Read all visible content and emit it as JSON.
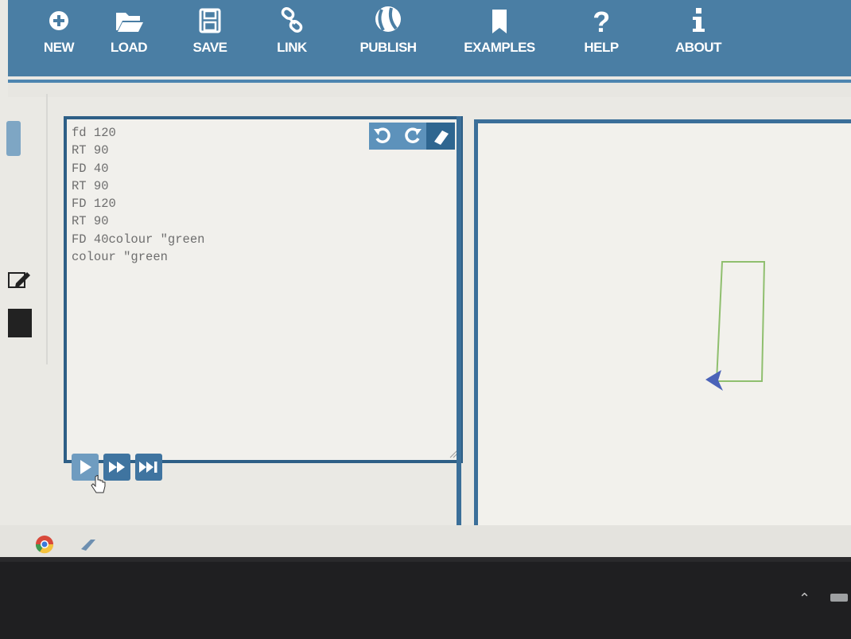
{
  "toolbar": {
    "items": [
      {
        "label": "NEW",
        "icon": "plus-circle-icon"
      },
      {
        "label": "LOAD",
        "icon": "folder-open-icon"
      },
      {
        "label": "SAVE",
        "icon": "floppy-disk-icon"
      },
      {
        "label": "LINK",
        "icon": "link-icon"
      },
      {
        "label": "PUBLISH",
        "icon": "globe-icon"
      },
      {
        "label": "EXAMPLES",
        "icon": "bookmark-icon"
      },
      {
        "label": "HELP",
        "icon": "question-icon"
      },
      {
        "label": "ABOUT",
        "icon": "info-icon"
      }
    ],
    "background_color": "#4a7ea4"
  },
  "editor": {
    "lines": [
      "fd 120",
      "RT 90",
      "FD 40",
      "RT 90",
      "FD 120",
      "RT 90",
      "FD 40colour \"green",
      "colour \"green"
    ],
    "actions": [
      {
        "icon": "undo-icon"
      },
      {
        "icon": "redo-icon"
      },
      {
        "icon": "eraser-icon"
      }
    ]
  },
  "run_controls": [
    {
      "icon": "play-icon"
    },
    {
      "icon": "fast-forward-icon"
    },
    {
      "icon": "skip-to-end-icon"
    }
  ],
  "canvas": {
    "turtle_color": "#4b63b8",
    "path_color": "#8fbf6e"
  },
  "taskbar": {
    "apps": [
      {
        "icon": "chrome-icon"
      },
      {
        "icon": "app-icon"
      }
    ]
  }
}
